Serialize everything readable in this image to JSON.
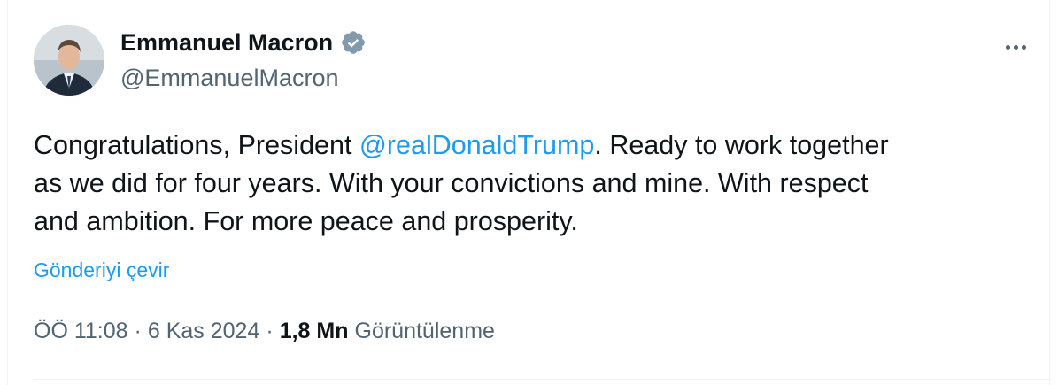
{
  "author": {
    "name": "Emmanuel Macron",
    "handle": "@EmmanuelMacron",
    "verified_color": "#829aab"
  },
  "tweet": {
    "text_before": "Congratulations, President ",
    "mention": "@realDonaldTrump",
    "text_after": ". Ready to work together\nas we did for four years. With your convictions and mine. With respect\nand ambition. For more peace and prosperity."
  },
  "translate_label": "Gönderiyi çevir",
  "meta": {
    "time": "ÖÖ 11:08",
    "separator": "·",
    "date": "6 Kas 2024",
    "views_count": "1,8 Mn",
    "views_label": "Görüntülenme"
  },
  "colors": {
    "link": "#1d9bf0",
    "secondary_text": "#536471",
    "primary_text": "#0f1419"
  },
  "icons": {
    "verified": "verified-badge-icon",
    "more": "more-options-icon"
  }
}
